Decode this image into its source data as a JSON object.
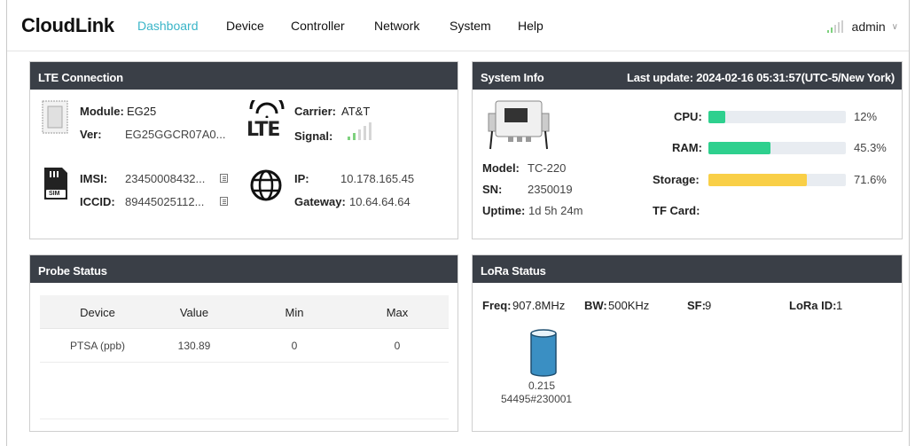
{
  "brand": "CloudLink",
  "nav": [
    "Dashboard",
    "Device",
    "Controller",
    "Network",
    "System",
    "Help"
  ],
  "user": {
    "name": "admin",
    "signal_bars_on": 2
  },
  "lte": {
    "title": "LTE Connection",
    "module_label": "Module:",
    "module_value": "EG25",
    "ver_label": "Ver:",
    "ver_value": "EG25GGCR07A0...",
    "carrier_label": "Carrier:",
    "carrier_value": "AT&T",
    "signal_label": "Signal:",
    "lte_logo": "LTE",
    "imsi_label": "IMSI:",
    "imsi_value": "23450008432...",
    "iccid_label": "ICCID:",
    "iccid_value": "89445025112...",
    "sim_text": "SIM",
    "ip_label": "IP:",
    "ip_value": "10.178.165.45",
    "gateway_label": "Gateway:",
    "gateway_value": "10.64.64.64"
  },
  "system": {
    "title": "System Info",
    "last_update": "Last update: 2024-02-16 05:31:57(UTC-5/New York)",
    "model_label": "Model:",
    "model_value": "TC-220",
    "sn_label": "SN:",
    "sn_value": "2350019",
    "uptime_label": "Uptime:",
    "uptime_value": "1d 5h 24m",
    "cpu_label": "CPU:",
    "cpu_value": "12%",
    "cpu_pct": 12,
    "ram_label": "RAM:",
    "ram_value": "45.3%",
    "ram_pct": 45.3,
    "storage_label": "Storage:",
    "storage_value": "71.6%",
    "storage_pct": 71.6,
    "tf_label": "TF Card:",
    "colors": {
      "cpu": "#2ed08e",
      "ram": "#2ed08e",
      "storage": "#f9cf47"
    }
  },
  "probe": {
    "title": "Probe Status",
    "columns": [
      "Device",
      "Value",
      "Min",
      "Max"
    ],
    "rows": [
      [
        "PTSA (ppb)",
        "130.89",
        "0",
        "0"
      ]
    ]
  },
  "lora": {
    "title": "LoRa Status",
    "freq_label": "Freq:",
    "freq_value": "907.8MHz",
    "bw_label": "BW:",
    "bw_value": "500KHz",
    "sf_label": "SF:",
    "sf_value": "9",
    "id_label": "LoRa ID:",
    "id_value": "1",
    "tank_value": "0.215",
    "tank_id": "54495#230001",
    "tank_color": "#3a8fc3"
  }
}
